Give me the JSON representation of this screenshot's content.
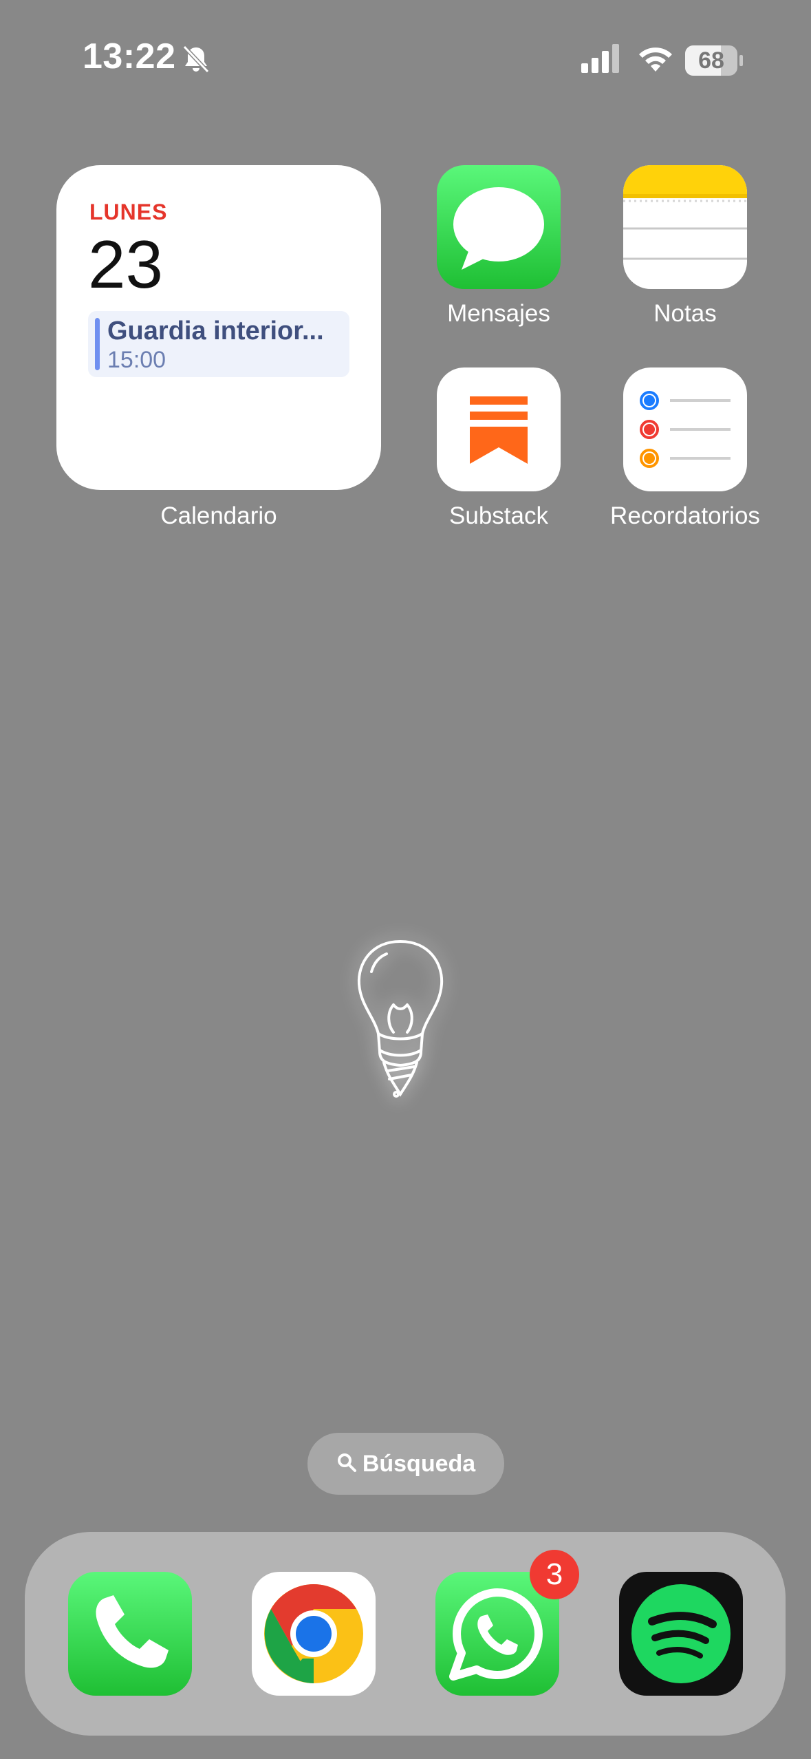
{
  "status_bar": {
    "time": "13:22",
    "battery_level": "68",
    "icons": [
      "bell-slash-icon",
      "cellular-signal-icon",
      "wifi-icon",
      "battery-icon"
    ]
  },
  "calendar_widget": {
    "day": "LUNES",
    "date": "23",
    "event_title": "Guardia interior...",
    "event_time": "15:00",
    "label": "Calendario"
  },
  "apps": {
    "messages": "Mensajes",
    "notes": "Notas",
    "substack": "Substack",
    "reminders": "Recordatorios"
  },
  "search": {
    "label": "Búsqueda"
  },
  "dock": {
    "apps": [
      "Phone",
      "Chrome",
      "WhatsApp",
      "Spotify"
    ],
    "whatsapp_badge": "3"
  },
  "colors": {
    "wallpaper": "#888888",
    "calendar_red": "#e5352b",
    "badge_red": "#f03a32",
    "substack_orange": "#ff6719"
  }
}
